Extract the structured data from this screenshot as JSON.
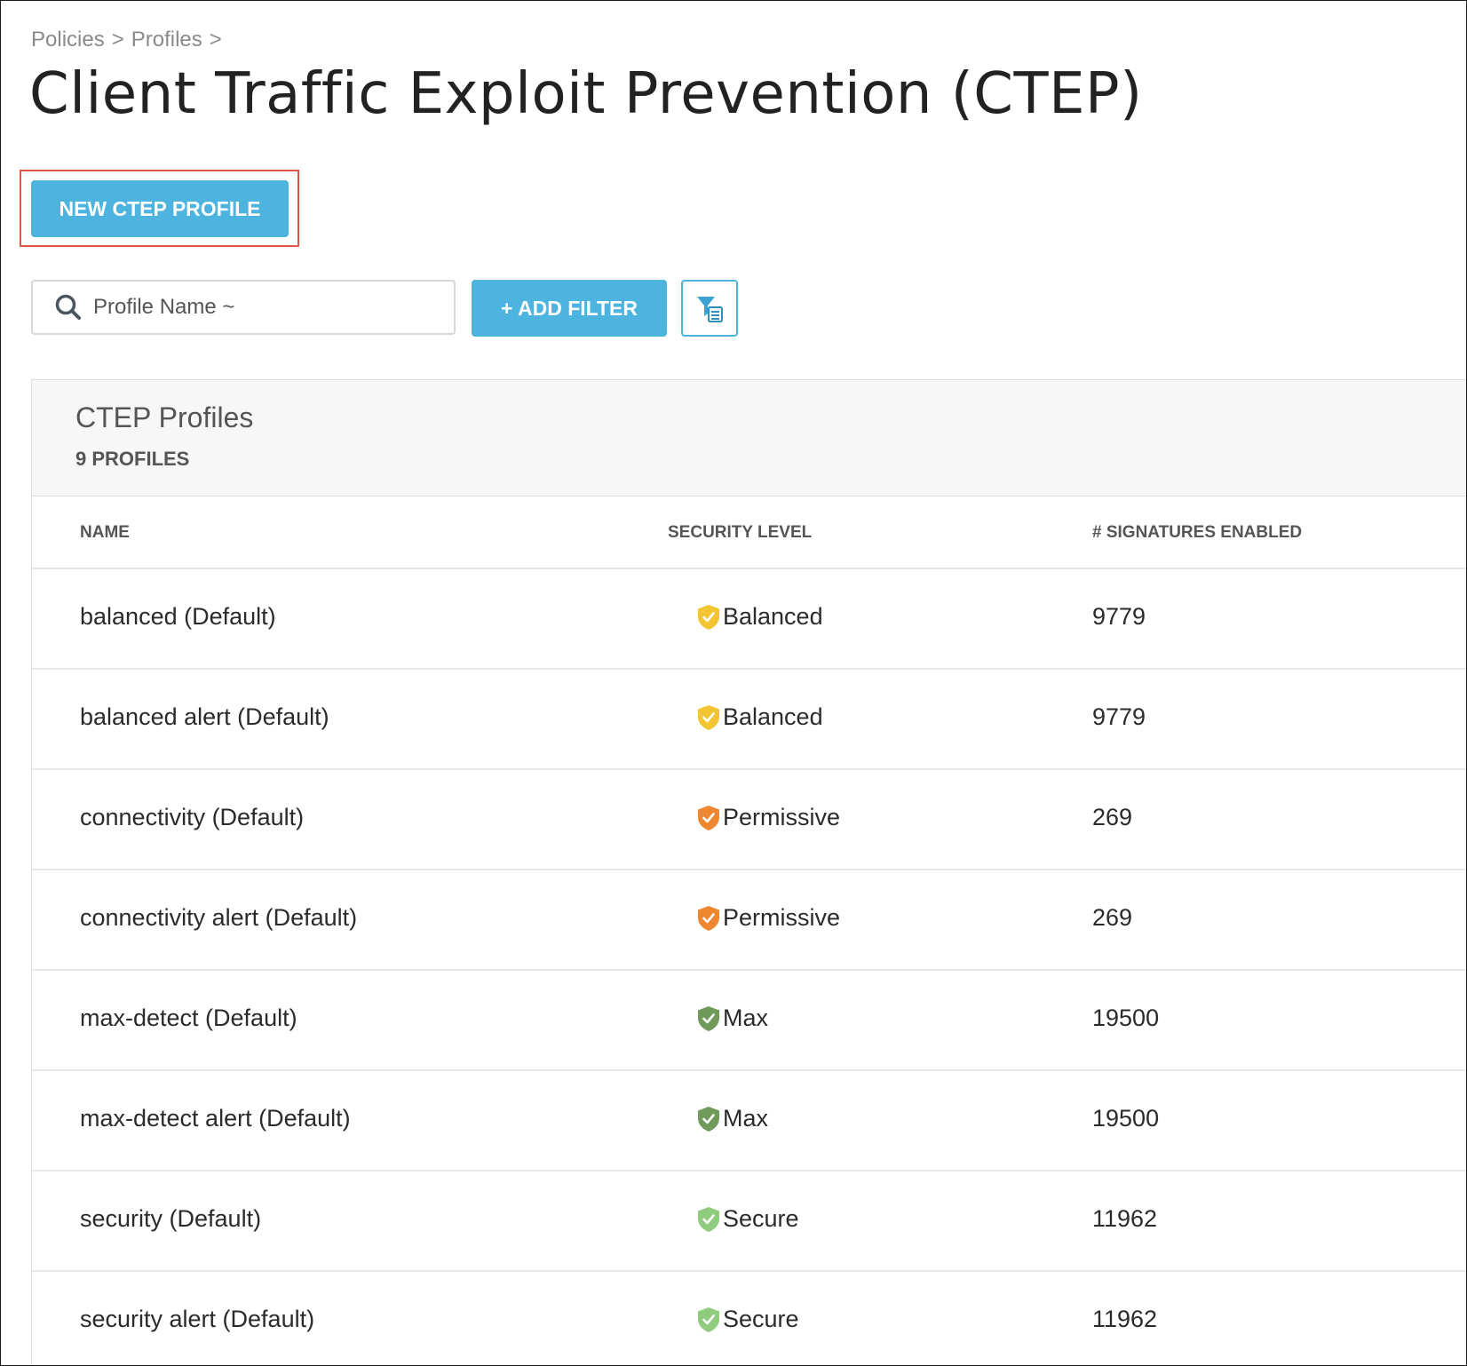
{
  "breadcrumb": {
    "items": [
      "Policies",
      "Profiles"
    ],
    "separator": ">"
  },
  "page_title": "Client Traffic Exploit Prevention (CTEP)",
  "new_profile_button": "NEW CTEP PROFILE",
  "search": {
    "placeholder": "Profile Name ~"
  },
  "add_filter_button": "+ ADD FILTER",
  "panel": {
    "title": "CTEP Profiles",
    "count": "9 PROFILES"
  },
  "table": {
    "columns": {
      "name": "NAME",
      "level": "SECURITY LEVEL",
      "signatures": "# SIGNATURES ENABLED"
    },
    "rows": [
      {
        "name": "balanced (Default)",
        "level": "Balanced",
        "level_color": "#f2c531",
        "signatures": "9779"
      },
      {
        "name": "balanced alert (Default)",
        "level": "Balanced",
        "level_color": "#f2c531",
        "signatures": "9779"
      },
      {
        "name": "connectivity (Default)",
        "level": "Permissive",
        "level_color": "#ee8730",
        "signatures": "269"
      },
      {
        "name": "connectivity alert (Default)",
        "level": "Permissive",
        "level_color": "#ee8730",
        "signatures": "269"
      },
      {
        "name": "max-detect (Default)",
        "level": "Max",
        "level_color": "#6f9a5a",
        "signatures": "19500"
      },
      {
        "name": "max-detect alert (Default)",
        "level": "Max",
        "level_color": "#6f9a5a",
        "signatures": "19500"
      },
      {
        "name": "security (Default)",
        "level": "Secure",
        "level_color": "#8fcc7e",
        "signatures": "11962"
      },
      {
        "name": "security alert (Default)",
        "level": "Secure",
        "level_color": "#8fcc7e",
        "signatures": "11962"
      }
    ]
  },
  "colors": {
    "accent": "#4db3df",
    "highlight": "#e0574a"
  },
  "icons": {
    "search": "search-icon",
    "filter_list": "filter-list-icon",
    "shield": "shield-check-icon"
  }
}
